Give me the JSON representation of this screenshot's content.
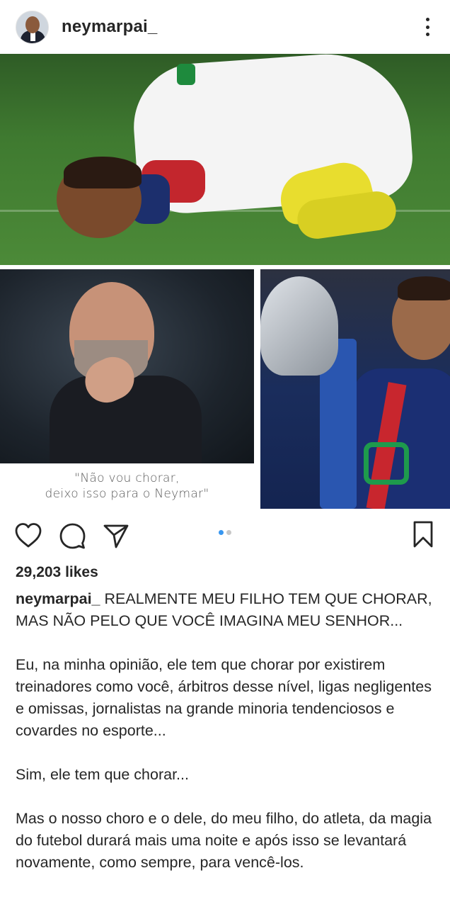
{
  "post": {
    "username": "neymarpai_",
    "likes": "29,203 likes",
    "image_caption_line1": "\"Não vou chorar,",
    "image_caption_line2": "deixo isso para o Neymar\"",
    "caption_first": "REALMENTE MEU FILHO TEM QUE CHORAR, MAS NÃO PELO QUE VOCÊ IMAGINA MEU SENHOR...",
    "paragraphs": [
      "Eu, na minha opinião, ele tem que chorar por existirem treinadores como você, árbitros desse nível, ligas negligentes e omissas, jornalistas na grande minoria tendenciosos e covardes no esporte...",
      "Sim, ele tem que chorar...",
      "Mas o nosso choro e o dele, do meu filho, do atleta, da magia do futebol durará mais uma noite e após isso se levantará novamente, como sempre, para vencê-los."
    ]
  },
  "icons": {
    "more": "more-vertical-icon",
    "like": "heart-icon",
    "comment": "comment-icon",
    "share": "send-icon",
    "save": "bookmark-icon"
  },
  "carousel": {
    "count": 2,
    "active_index": 0,
    "active_color": "#3897f0"
  },
  "colors": {
    "text": "#262626",
    "dot_inactive": "#c7c7c7"
  }
}
